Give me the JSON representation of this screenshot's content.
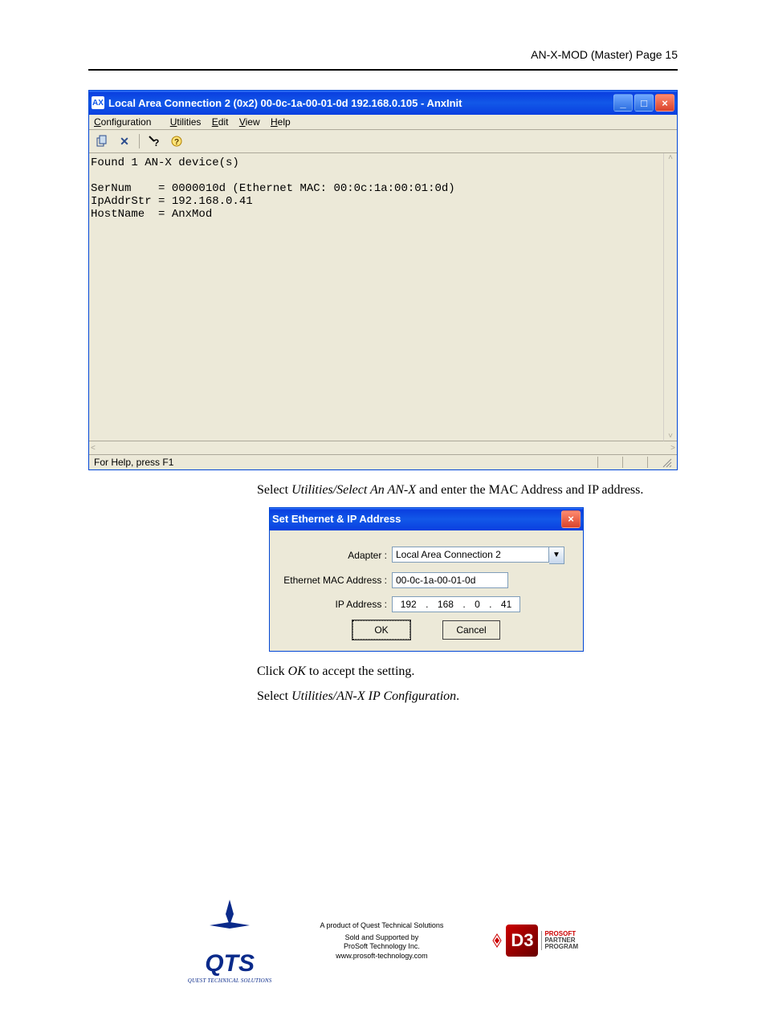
{
  "page_header": "AN-X-MOD (Master) Page 15",
  "main_window": {
    "title": "Local Area Connection 2 (0x2) 00-0c-1a-00-01-0d  192.168.0.105 - AnxInit",
    "menu": {
      "configuration": "Configuration",
      "utilities": "Utilities",
      "edit": "Edit",
      "view": "View",
      "help": "Help"
    },
    "content": "Found 1 AN-X device(s)\n\nSerNum    = 0000010d (Ethernet MAC: 00:0c:1a:00:01:0d)\nIpAddrStr = 192.168.0.41\nHostName  = AnxMod",
    "status": "For Help, press F1"
  },
  "text1_a": "Select ",
  "text1_b": "Utilities/Select An AN-X",
  "text1_c": " and enter the MAC Address and IP address.",
  "dialog": {
    "title": "Set Ethernet & IP Address",
    "adapter_label": "Adapter :",
    "adapter_value": "Local Area Connection 2",
    "mac_label": "Ethernet MAC Address :",
    "mac_value": "00-0c-1a-00-01-0d",
    "ip_label": "IP Address :",
    "ip_1": "192",
    "ip_2": "168",
    "ip_3": "0",
    "ip_4": "41",
    "ok": "OK",
    "cancel": "Cancel"
  },
  "text2_a": "Click ",
  "text2_b": "OK",
  "text2_c": " to accept the setting.",
  "text3_a": "Select ",
  "text3_b": "Utilities/AN-X IP Configuration",
  "text3_c": ".",
  "footer": {
    "line1": "A product of Quest Technical Solutions",
    "line2": "Sold and Supported by",
    "line3": "ProSoft Technology Inc.",
    "line4": "www.prosoft-technology.com",
    "qts_sub": "QUEST TECHNICAL SOLUTIONS",
    "prosoft1": "PROSOFT",
    "prosoft2": "PARTNER",
    "prosoft3": "PROGRAM"
  }
}
